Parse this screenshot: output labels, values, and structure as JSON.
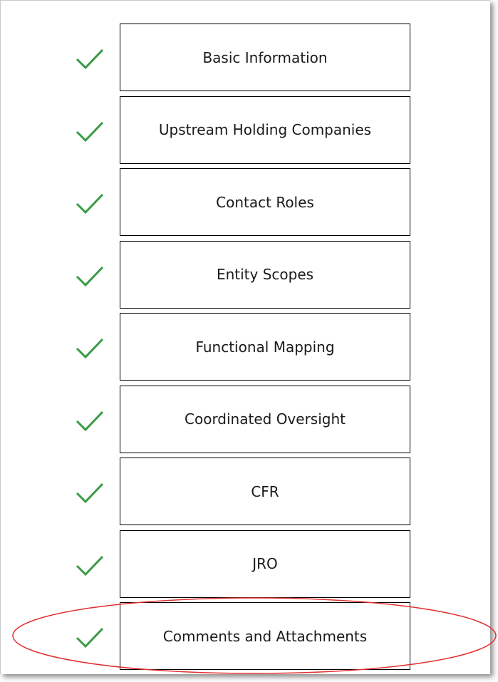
{
  "colors": {
    "check": "#3a9a44",
    "border": "#000000",
    "highlight": "#e03030"
  },
  "steps": [
    {
      "label": "Basic Information",
      "status": "complete",
      "icon": "checkmark-icon"
    },
    {
      "label": "Upstream Holding Companies",
      "status": "complete",
      "icon": "checkmark-icon"
    },
    {
      "label": "Contact Roles",
      "status": "complete",
      "icon": "checkmark-icon"
    },
    {
      "label": "Entity Scopes",
      "status": "complete",
      "icon": "checkmark-icon"
    },
    {
      "label": "Functional Mapping",
      "status": "complete",
      "icon": "checkmark-icon"
    },
    {
      "label": "Coordinated Oversight",
      "status": "complete",
      "icon": "checkmark-icon"
    },
    {
      "label": "CFR",
      "status": "complete",
      "icon": "checkmark-icon"
    },
    {
      "label": "JRO",
      "status": "complete",
      "icon": "checkmark-icon"
    },
    {
      "label": "Comments and Attachments",
      "status": "complete",
      "icon": "checkmark-icon"
    }
  ]
}
